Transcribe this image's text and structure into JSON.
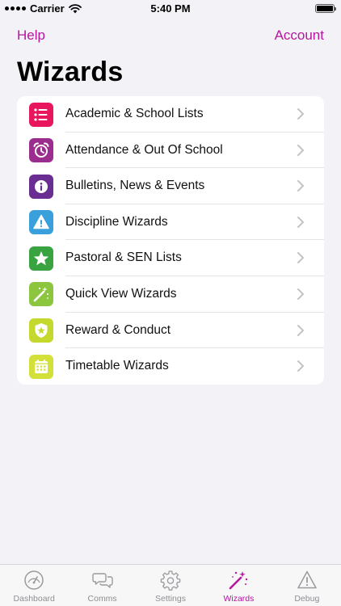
{
  "status_bar": {
    "carrier": "Carrier",
    "time": "5:40 PM"
  },
  "nav": {
    "left_label": "Help",
    "right_label": "Account"
  },
  "page_title": "Wizards",
  "wizards": [
    {
      "label": "Academic & School Lists",
      "icon": "list-icon",
      "color": "#e8175d"
    },
    {
      "label": "Attendance & Out Of School",
      "icon": "alarm-clock-icon",
      "color": "#9b2d8f"
    },
    {
      "label": "Bulletins, News & Events",
      "icon": "info-icon",
      "color": "#6a2d91"
    },
    {
      "label": "Discipline Wizards",
      "icon": "warning-icon",
      "color": "#3aa0dc"
    },
    {
      "label": "Pastoral & SEN Lists",
      "icon": "star-icon",
      "color": "#3aa341"
    },
    {
      "label": "Quick View Wizards",
      "icon": "magic-wand-icon",
      "color": "#8cc63f"
    },
    {
      "label": "Reward & Conduct",
      "icon": "shield-star-icon",
      "color": "#c5d82d"
    },
    {
      "label": "Timetable Wizards",
      "icon": "calendar-icon",
      "color": "#d4e03a"
    }
  ],
  "tab_bar": [
    {
      "label": "Dashboard",
      "icon": "speedometer-icon"
    },
    {
      "label": "Comms",
      "icon": "chat-bubbles-icon"
    },
    {
      "label": "Settings",
      "icon": "gear-icon"
    },
    {
      "label": "Wizards",
      "icon": "magic-wand-icon",
      "active": true
    },
    {
      "label": "Debug",
      "icon": "warning-icon"
    }
  ],
  "accent_color": "#b5179e"
}
